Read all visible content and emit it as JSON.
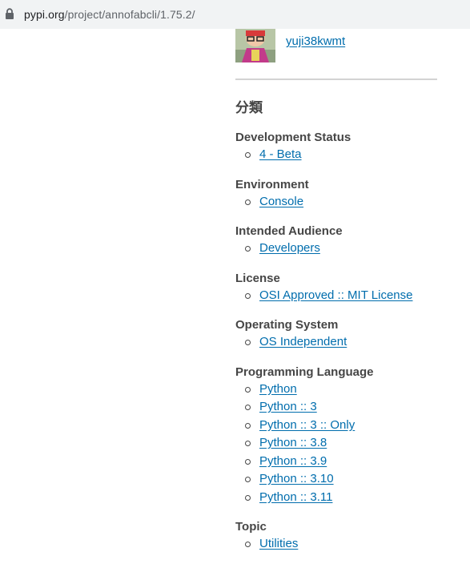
{
  "browser": {
    "url_host": "pypi.org",
    "url_path": "/project/annofabcli/1.75.2/"
  },
  "maintainer": {
    "username": "yuji38kwmt"
  },
  "classifiers": {
    "title": "分類",
    "groups": [
      {
        "title": "Development Status",
        "items": [
          "4 - Beta"
        ]
      },
      {
        "title": "Environment",
        "items": [
          "Console"
        ]
      },
      {
        "title": "Intended Audience",
        "items": [
          "Developers"
        ]
      },
      {
        "title": "License",
        "items": [
          "OSI Approved :: MIT License"
        ]
      },
      {
        "title": "Operating System",
        "items": [
          "OS Independent"
        ]
      },
      {
        "title": "Programming Language",
        "items": [
          "Python",
          "Python :: 3",
          "Python :: 3 :: Only",
          "Python :: 3.8",
          "Python :: 3.9",
          "Python :: 3.10",
          "Python :: 3.11"
        ]
      },
      {
        "title": "Topic",
        "items": [
          "Utilities"
        ]
      }
    ]
  },
  "colors": {
    "link": "#006dad",
    "text": "#464646",
    "urlbar_bg": "#f1f3f4",
    "divider": "#d3d3d3"
  }
}
